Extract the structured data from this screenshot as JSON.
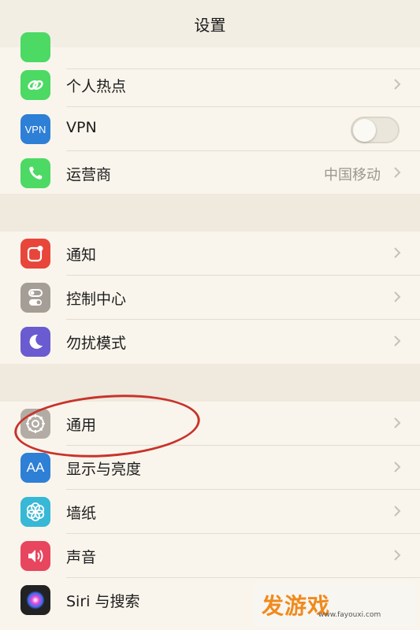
{
  "nav": {
    "title": "设置"
  },
  "rows": {
    "hotspot": {
      "label": "个人热点",
      "icon": "hotspot-link-icon",
      "color": "#4cd964"
    },
    "vpn": {
      "label": "VPN",
      "icon_text": "VPN",
      "color": "#2e7fd6",
      "toggle": false
    },
    "carrier": {
      "label": "运营商",
      "detail": "中国移动",
      "icon": "phone-icon",
      "color": "#4cd964"
    },
    "notifications": {
      "label": "通知",
      "icon": "notification-icon",
      "color": "#e8463b"
    },
    "control_center": {
      "label": "控制中心",
      "icon": "switches-icon",
      "color": "#a59e96"
    },
    "dnd": {
      "label": "勿扰模式",
      "icon": "moon-icon",
      "color": "#6a5bd0"
    },
    "general": {
      "label": "通用",
      "icon": "gear-icon",
      "color": "#b2aca4"
    },
    "display": {
      "label": "显示与亮度",
      "icon_text": "AA",
      "color": "#2e7fd6"
    },
    "wallpaper": {
      "label": "墙纸",
      "icon": "flower-icon",
      "color": "#36b8d6"
    },
    "sounds": {
      "label": "声音",
      "icon": "speaker-icon",
      "color": "#e8455f"
    },
    "siri": {
      "label": "Siri 与搜索",
      "icon": "siri-icon",
      "color": "#222222"
    }
  },
  "watermark": {
    "logo": "发游戏",
    "url": "www.fayouxi.com"
  }
}
